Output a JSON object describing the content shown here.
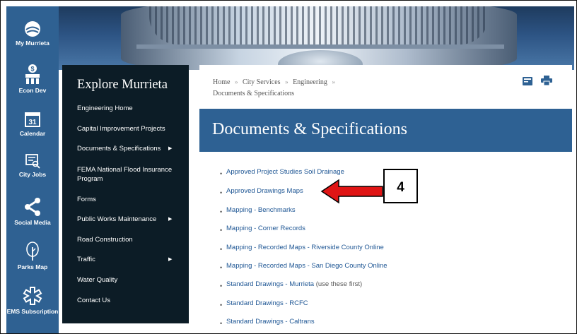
{
  "rail": {
    "items": [
      {
        "label": "My Murrieta",
        "icon": "my-murrieta-logo"
      },
      {
        "label": "Econ Dev",
        "icon": "econ-dev-icon"
      },
      {
        "label": "Calendar",
        "icon": "calendar-icon",
        "day": "31"
      },
      {
        "label": "City Jobs",
        "icon": "city-jobs-icon"
      },
      {
        "label": "Social Media",
        "icon": "share-icon"
      },
      {
        "label": "Parks Map",
        "icon": "tree-icon"
      },
      {
        "label": "EMS Subscription",
        "icon": "star-of-life-icon"
      }
    ]
  },
  "explore": {
    "title": "Explore Murrieta",
    "items": [
      {
        "label": "Engineering Home",
        "has_submenu": false
      },
      {
        "label": "Capital Improvement Projects",
        "has_submenu": false
      },
      {
        "label": "Documents & Specifications",
        "has_submenu": true
      },
      {
        "label": "FEMA National Flood Insurance Program",
        "has_submenu": false
      },
      {
        "label": "Forms",
        "has_submenu": false
      },
      {
        "label": "Public Works Maintenance",
        "has_submenu": true
      },
      {
        "label": "Road Construction",
        "has_submenu": false
      },
      {
        "label": "Traffic",
        "has_submenu": true
      },
      {
        "label": "Water Quality",
        "has_submenu": false
      },
      {
        "label": "Contact Us",
        "has_submenu": false
      }
    ]
  },
  "breadcrumb": {
    "items": [
      "Home",
      "City Services",
      "Engineering",
      "Documents & Specifications"
    ],
    "separator": "»"
  },
  "page": {
    "title": "Documents & Specifications",
    "links": [
      {
        "label": "Approved Project Studies Soil Drainage",
        "note": ""
      },
      {
        "label": "Approved Drawings Maps",
        "note": ""
      },
      {
        "label": "Mapping - Benchmarks",
        "note": ""
      },
      {
        "label": "Mapping - Corner Records",
        "note": ""
      },
      {
        "label": "Mapping - Recorded Maps - Riverside County Online",
        "note": ""
      },
      {
        "label": "Mapping - Recorded Maps - San Diego County Online",
        "note": ""
      },
      {
        "label": "Standard Drawings - Murrieta",
        "note": " (use these first)"
      },
      {
        "label": "Standard Drawings - RCFC",
        "note": ""
      },
      {
        "label": "Standard Drawings - Caltrans",
        "note": ""
      }
    ]
  },
  "toolbar": {
    "icons": [
      "email-icon",
      "print-icon"
    ]
  },
  "callout": {
    "label": "4"
  },
  "colors": {
    "rail": "#2f6192",
    "nav_bg": "#0c1c26",
    "header_bar": "#2e6193",
    "link": "#1e5694",
    "arrow": "#e01515"
  }
}
